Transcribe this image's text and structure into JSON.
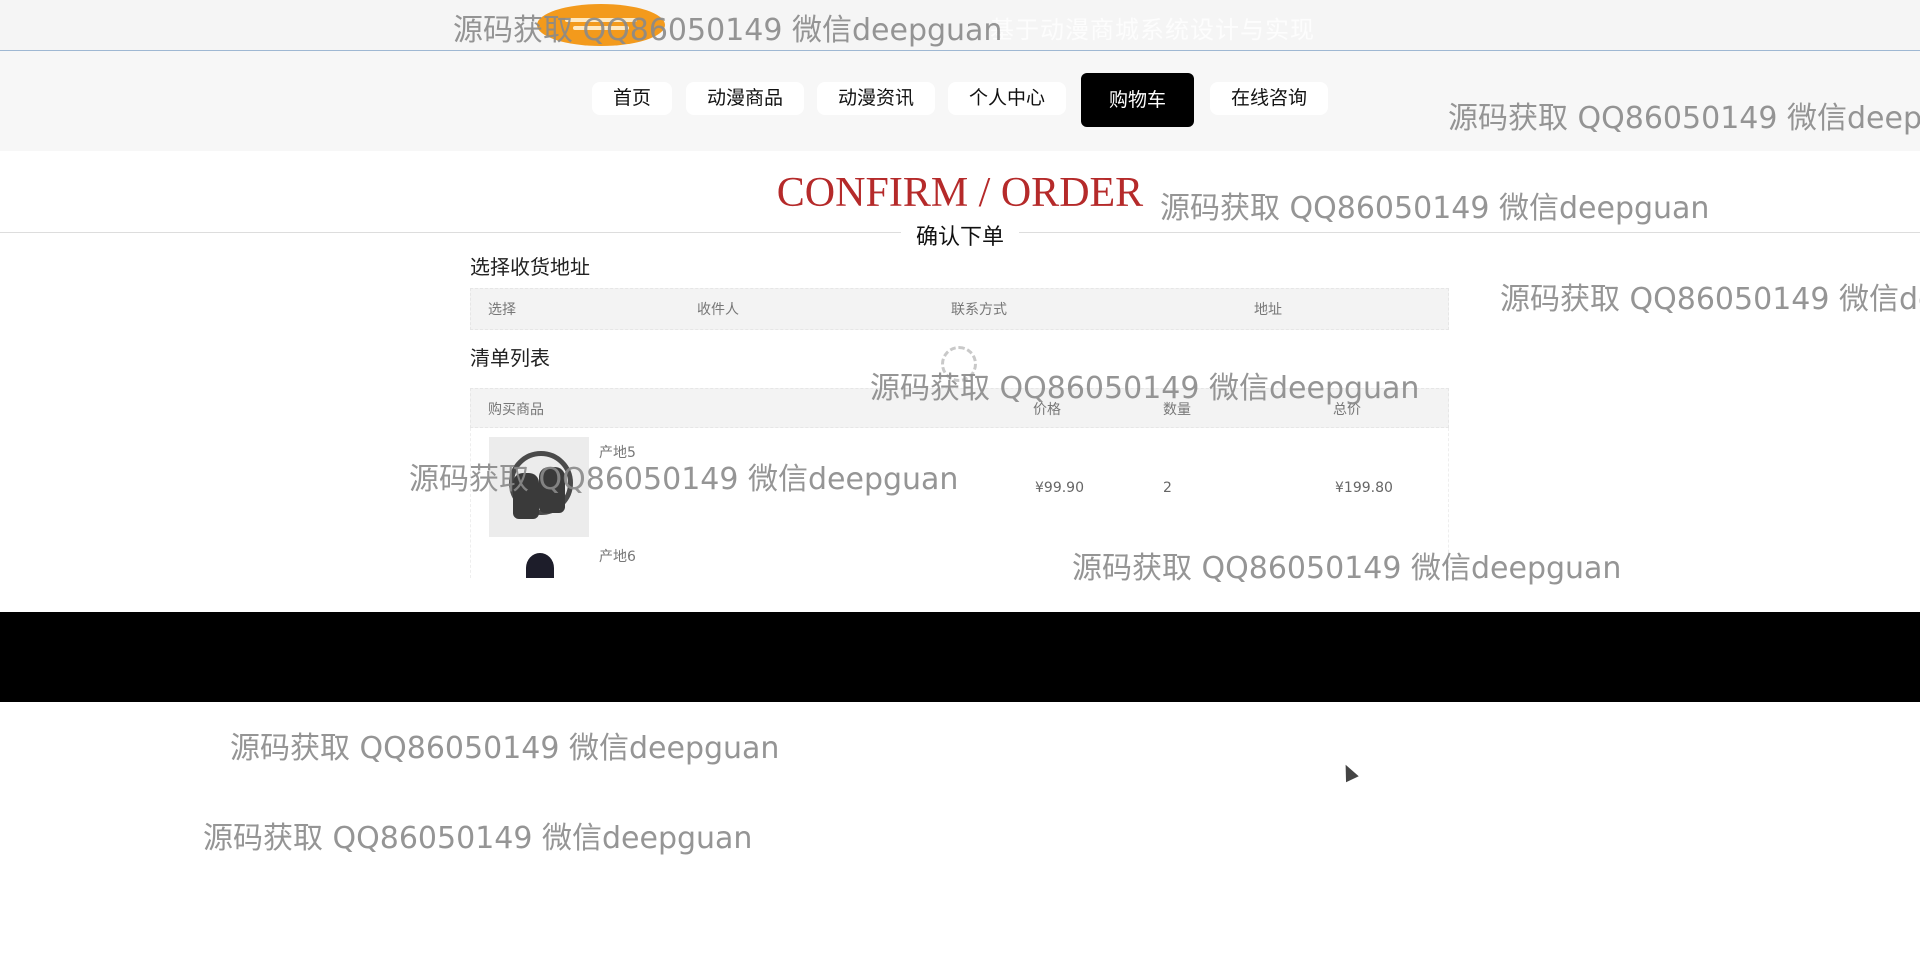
{
  "header": {
    "site_title": "基于动漫商城系统设计与实现"
  },
  "nav": {
    "items": [
      {
        "label": "首页"
      },
      {
        "label": "动漫商品"
      },
      {
        "label": "动漫资讯"
      },
      {
        "label": "个人中心"
      },
      {
        "label": "购物车",
        "active": true
      },
      {
        "label": "在线咨询"
      }
    ]
  },
  "page": {
    "title": "CONFIRM / ORDER",
    "subtitle": "确认下单"
  },
  "address_section": {
    "label": "选择收货地址",
    "columns": [
      "选择",
      "收件人",
      "联系方式",
      "地址"
    ]
  },
  "order_section": {
    "label": "清单列表",
    "columns": [
      "购买商品",
      "价格",
      "数量",
      "总价"
    ],
    "items": [
      {
        "name": "产地5",
        "price": "¥99.90",
        "quantity": "2",
        "total": "¥199.80"
      },
      {
        "name": "产地6",
        "price": "",
        "quantity": "",
        "total": ""
      }
    ]
  },
  "watermark": {
    "text": "源码获取 QQ86050149 微信deepguan"
  },
  "icons": {
    "logo": "anime-mall-logo",
    "loading": "loading-spinner-icon",
    "cursor": "mouse-cursor-icon"
  },
  "colors": {
    "accent": "#b52a2a",
    "active_nav": "#000000",
    "logo": "#f39a1c",
    "footer": "#000000"
  }
}
